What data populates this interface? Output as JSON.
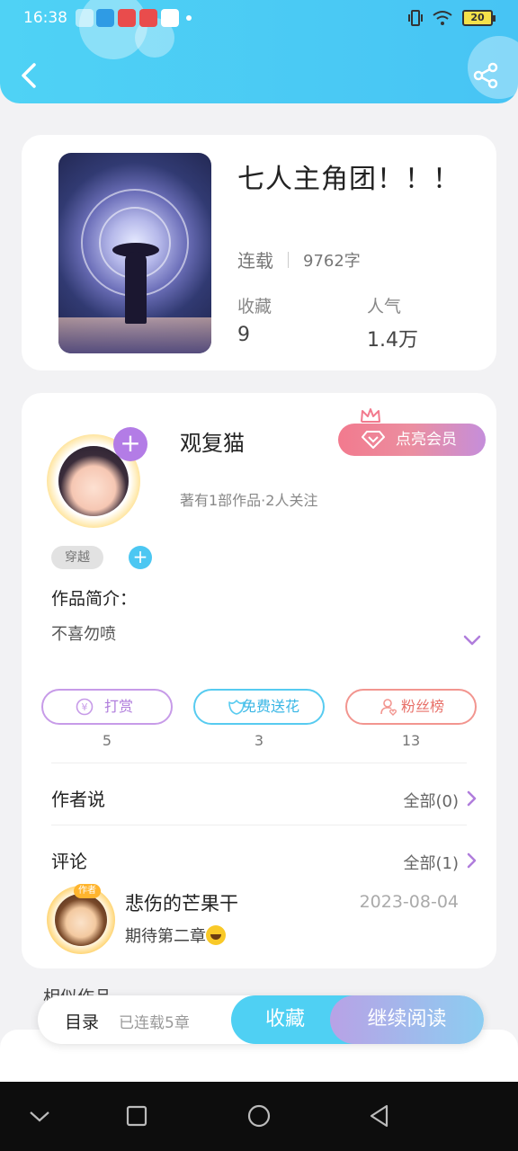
{
  "status_bar": {
    "time": "16:38",
    "battery": "20"
  },
  "book": {
    "title": "七人主角团！！！",
    "status": "连载",
    "word_count": "9762字",
    "favorites_label": "收藏",
    "favorites_value": "9",
    "popularity_label": "人气",
    "popularity_value": "1.4万"
  },
  "author": {
    "name": "观复猫",
    "summary": "著有1部作品·2人关注",
    "vip_button": "点亮会员",
    "tag": "穿越",
    "intro_label": "作品简介：",
    "intro_text": "不喜勿喷"
  },
  "actions": [
    {
      "label": "打赏",
      "count": "5",
      "icon": "yen-coin-icon"
    },
    {
      "label": "免费送花",
      "count": "3",
      "icon": "flower-icon"
    },
    {
      "label": "粉丝榜",
      "count": "13",
      "icon": "fans-icon"
    }
  ],
  "author_says": {
    "title": "作者说",
    "all": "全部(0)"
  },
  "comments": {
    "title": "评论",
    "all": "全部(1)",
    "items": [
      {
        "badge": "作者",
        "name": "悲伤的芒果干",
        "date": "2023-08-04",
        "text": "期待第二章"
      }
    ]
  },
  "similar_title": "相似作品",
  "bottom_bar": {
    "toc": "目录",
    "toc_status": "已连载5章",
    "collect": "收藏",
    "read": "继续阅读"
  },
  "colors": {
    "header": "#4fd2f5",
    "vip": "#f27a8e",
    "purple": "#b07ddc",
    "cyan": "#38b6e5",
    "coral": "#e8716a"
  }
}
